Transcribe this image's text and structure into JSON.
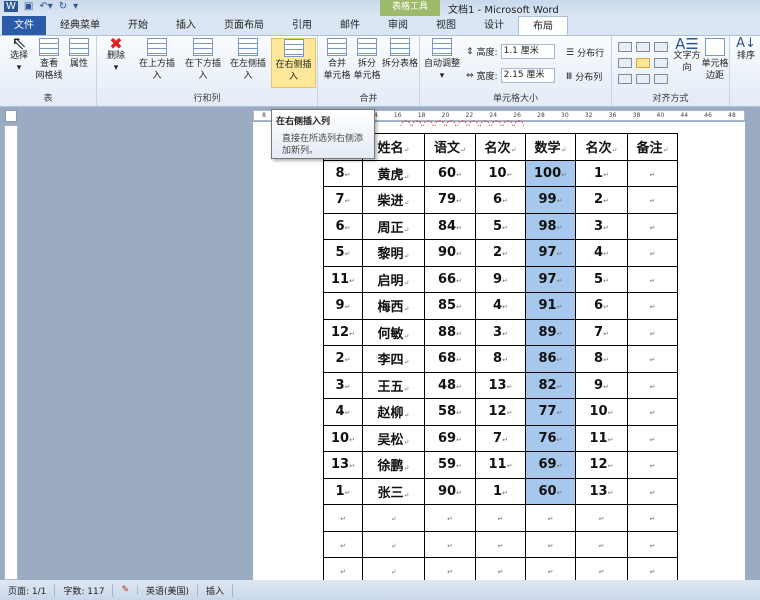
{
  "window": {
    "title": "文档1 - Microsoft Word",
    "context_tool": "表格工具"
  },
  "tabs": [
    "文件",
    "经典菜单",
    "开始",
    "插入",
    "页面布局",
    "引用",
    "邮件",
    "审阅",
    "视图",
    "设计",
    "布局"
  ],
  "ribbon": {
    "table_group": {
      "label": "表",
      "select": "选择",
      "gridlines": "查看\n网格线",
      "properties": "属性"
    },
    "rowcol_group": {
      "label": "行和列",
      "delete": "删除",
      "above": "在上方插入",
      "below": "在下方插入",
      "left": "在左侧插入",
      "right": "在右侧插入"
    },
    "merge_group": {
      "label": "合并",
      "merge": "合并\n单元格",
      "split": "拆分\n单元格",
      "split_table": "拆分表格"
    },
    "size_group": {
      "label": "单元格大小",
      "autofit": "自动调整",
      "height_label": "高度:",
      "height": "1.1 厘米",
      "width_label": "宽度:",
      "width": "2.15 厘米",
      "dist_rows": "分布行",
      "dist_cols": "分布列"
    },
    "align_group": {
      "label": "对齐方式",
      "text_dir": "文字方向",
      "margins": "单元格\n边距"
    },
    "sort": "排序"
  },
  "tooltip": {
    "title": "在右侧插入列",
    "desc": "直接在所选列右侧添加新列。"
  },
  "ruler_ticks": [
    "8",
    "6",
    "8",
    "10",
    "12",
    "14",
    "16",
    "18",
    "20",
    "22",
    "24",
    "26",
    "28",
    "30",
    "32",
    "36",
    "38",
    "40",
    "44",
    "46",
    "48"
  ],
  "table": {
    "headers": [
      "",
      "姓名",
      "语文",
      "名次",
      "数学",
      "名次",
      "备注"
    ],
    "rows": [
      [
        "8",
        "黄虎",
        "60",
        "10",
        "100",
        "1",
        ""
      ],
      [
        "7",
        "柴进",
        "79",
        "6",
        "99",
        "2",
        ""
      ],
      [
        "6",
        "周正",
        "84",
        "5",
        "98",
        "3",
        ""
      ],
      [
        "5",
        "黎明",
        "90",
        "2",
        "97",
        "4",
        ""
      ],
      [
        "11",
        "启明",
        "66",
        "9",
        "97",
        "5",
        ""
      ],
      [
        "9",
        "梅西",
        "85",
        "4",
        "91",
        "6",
        ""
      ],
      [
        "12",
        "何敏",
        "88",
        "3",
        "89",
        "7",
        ""
      ],
      [
        "2",
        "李四",
        "68",
        "8",
        "86",
        "8",
        ""
      ],
      [
        "3",
        "王五",
        "48",
        "13",
        "82",
        "9",
        ""
      ],
      [
        "4",
        "赵柳",
        "58",
        "12",
        "77",
        "10",
        ""
      ],
      [
        "10",
        "吴松",
        "69",
        "7",
        "76",
        "11",
        ""
      ],
      [
        "13",
        "徐鹏",
        "59",
        "11",
        "69",
        "12",
        ""
      ],
      [
        "1",
        "张三",
        "90",
        "1",
        "60",
        "13",
        ""
      ],
      [
        "",
        "",
        "",
        "",
        "",
        "",
        ""
      ],
      [
        "",
        "",
        "",
        "",
        "",
        "",
        ""
      ],
      [
        "",
        "",
        "",
        "",
        "",
        "",
        ""
      ]
    ]
  },
  "status": {
    "page": "页面: 1/1",
    "words": "字数: 117",
    "lang": "英语(美国)",
    "mode": "插入"
  }
}
